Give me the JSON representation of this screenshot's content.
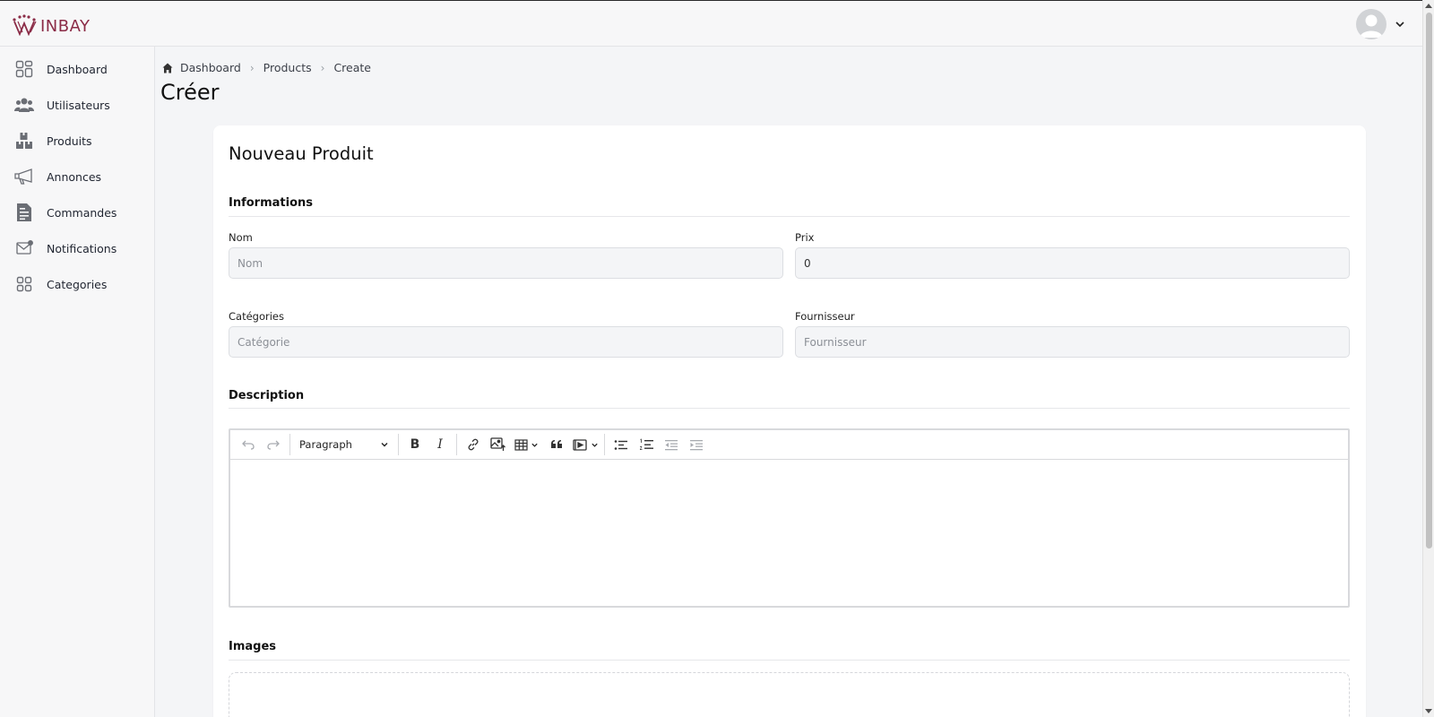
{
  "brand": {
    "name": "INBAY",
    "accent": "#8b2c47"
  },
  "header": {
    "avatar_icon": "user-avatar-icon"
  },
  "sidebar": {
    "items": [
      {
        "label": "Dashboard",
        "icon": "dashboard-grid-icon"
      },
      {
        "label": "Utilisateurs",
        "icon": "users-icon"
      },
      {
        "label": "Produits",
        "icon": "boxes-icon"
      },
      {
        "label": "Annonces",
        "icon": "megaphone-icon"
      },
      {
        "label": "Commandes",
        "icon": "document-icon"
      },
      {
        "label": "Notifications",
        "icon": "mail-notification-icon"
      },
      {
        "label": "Categories",
        "icon": "categories-grid-icon"
      }
    ]
  },
  "breadcrumb": {
    "home": "Dashboard",
    "section": "Products",
    "current": "Create"
  },
  "page": {
    "title": "Créer"
  },
  "form": {
    "title": "Nouveau Produit",
    "info_section": "Informations",
    "nom": {
      "label": "Nom",
      "placeholder": "Nom",
      "value": ""
    },
    "prix": {
      "label": "Prix",
      "placeholder": "",
      "value": "0"
    },
    "categories": {
      "label": "Catégories",
      "placeholder": "Catégorie"
    },
    "fournisseur": {
      "label": "Fournisseur",
      "placeholder": "Fournisseur"
    },
    "description_section": "Description",
    "editor": {
      "heading_select": "Paragraph"
    },
    "images_section": "Images"
  }
}
